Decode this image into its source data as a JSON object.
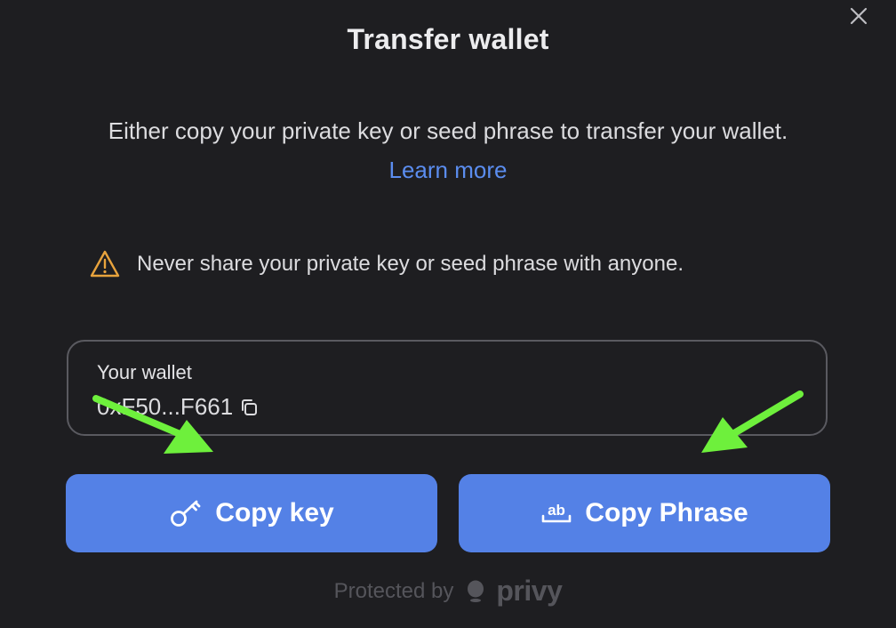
{
  "dialog": {
    "title": "Transfer wallet",
    "description": "Either copy your private key or seed phrase to transfer your wallet.",
    "learn_more": "Learn more",
    "warning": "Never share your private key or seed phrase with anyone.",
    "close_icon": "close-icon"
  },
  "wallet": {
    "label": "Your wallet",
    "address": "0xF50...F661",
    "copy_icon": "copy-icon"
  },
  "buttons": {
    "copy_key": "Copy key",
    "copy_key_icon": "key-icon",
    "copy_phrase": "Copy Phrase",
    "copy_phrase_icon": "ab-text-icon"
  },
  "footer": {
    "protected_by": "Protected by",
    "brand": "privy"
  },
  "colors": {
    "background": "#1e1e21",
    "accent": "#5481e6",
    "link": "#5b8def",
    "warning": "#e8a33d",
    "annotation_arrow": "#6ef03c"
  }
}
